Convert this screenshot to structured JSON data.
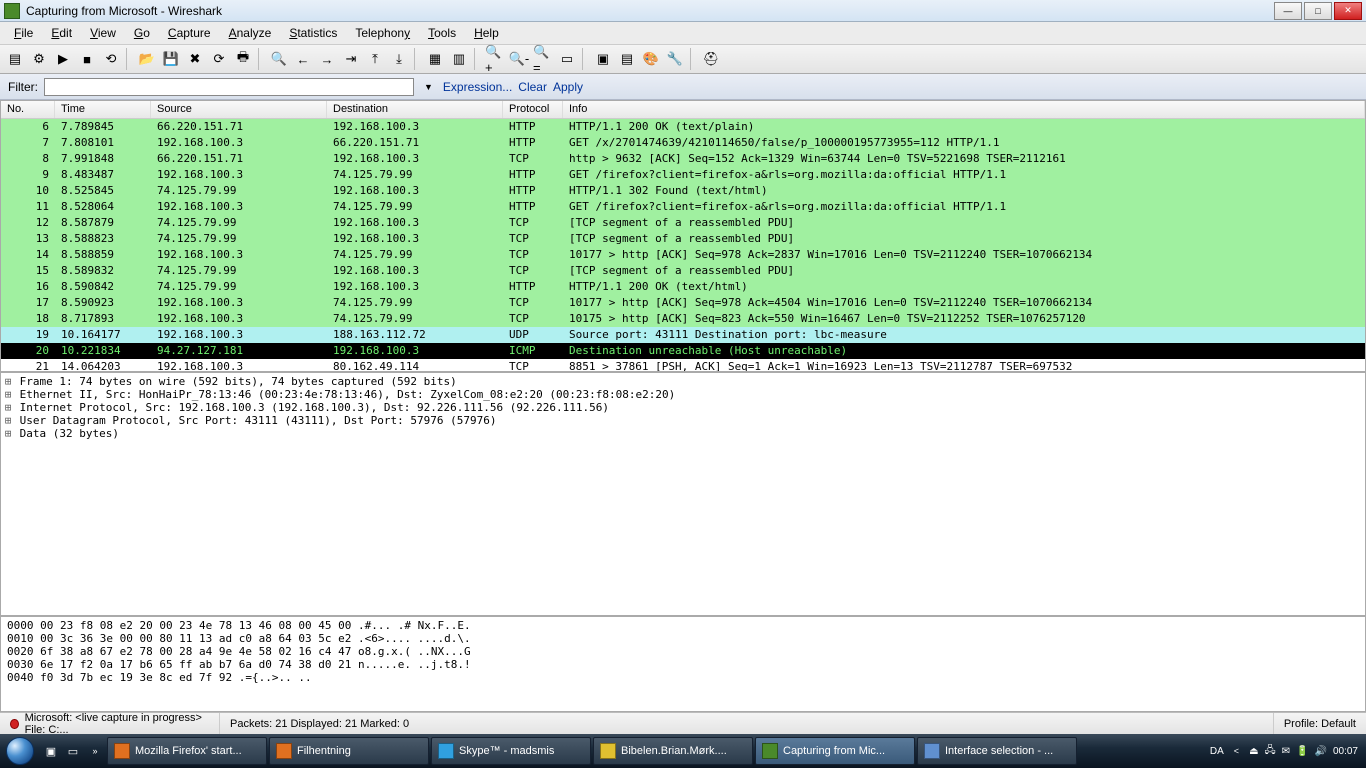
{
  "window": {
    "title": "Capturing from Microsoft - Wireshark"
  },
  "menu": {
    "file": "File",
    "edit": "Edit",
    "view": "View",
    "go": "Go",
    "capture": "Capture",
    "analyze": "Analyze",
    "statistics": "Statistics",
    "telephony": "Telephony",
    "tools": "Tools",
    "help": "Help"
  },
  "filter": {
    "label": "Filter:",
    "value": "",
    "expression": "Expression...",
    "clear": "Clear",
    "apply": "Apply"
  },
  "columns": {
    "no": "No.",
    "time": "Time",
    "source": "Source",
    "destination": "Destination",
    "protocol": "Protocol",
    "info": "Info"
  },
  "packets": [
    {
      "no": "6",
      "time": "7.789845",
      "src": "66.220.151.71",
      "dst": "192.168.100.3",
      "proto": "HTTP",
      "info": "HTTP/1.1 200 OK  (text/plain)",
      "cls": "row-green"
    },
    {
      "no": "7",
      "time": "7.808101",
      "src": "192.168.100.3",
      "dst": "66.220.151.71",
      "proto": "HTTP",
      "info": "GET /x/2701474639/4210114650/false/p_100000195773955=112 HTTP/1.1",
      "cls": "row-green"
    },
    {
      "no": "8",
      "time": "7.991848",
      "src": "66.220.151.71",
      "dst": "192.168.100.3",
      "proto": "TCP",
      "info": "http > 9632 [ACK] Seq=152 Ack=1329 Win=63744 Len=0 TSV=5221698 TSER=2112161",
      "cls": "row-green"
    },
    {
      "no": "9",
      "time": "8.483487",
      "src": "192.168.100.3",
      "dst": "74.125.79.99",
      "proto": "HTTP",
      "info": "GET /firefox?client=firefox-a&rls=org.mozilla:da:official HTTP/1.1",
      "cls": "row-green"
    },
    {
      "no": "10",
      "time": "8.525845",
      "src": "74.125.79.99",
      "dst": "192.168.100.3",
      "proto": "HTTP",
      "info": "HTTP/1.1 302 Found  (text/html)",
      "cls": "row-green"
    },
    {
      "no": "11",
      "time": "8.528064",
      "src": "192.168.100.3",
      "dst": "74.125.79.99",
      "proto": "HTTP",
      "info": "GET /firefox?client=firefox-a&rls=org.mozilla:da:official HTTP/1.1",
      "cls": "row-green"
    },
    {
      "no": "12",
      "time": "8.587879",
      "src": "74.125.79.99",
      "dst": "192.168.100.3",
      "proto": "TCP",
      "info": "[TCP segment of a reassembled PDU]",
      "cls": "row-green"
    },
    {
      "no": "13",
      "time": "8.588823",
      "src": "74.125.79.99",
      "dst": "192.168.100.3",
      "proto": "TCP",
      "info": "[TCP segment of a reassembled PDU]",
      "cls": "row-green"
    },
    {
      "no": "14",
      "time": "8.588859",
      "src": "192.168.100.3",
      "dst": "74.125.79.99",
      "proto": "TCP",
      "info": "10177 > http [ACK] Seq=978 Ack=2837 Win=17016 Len=0 TSV=2112240 TSER=1070662134",
      "cls": "row-green"
    },
    {
      "no": "15",
      "time": "8.589832",
      "src": "74.125.79.99",
      "dst": "192.168.100.3",
      "proto": "TCP",
      "info": "[TCP segment of a reassembled PDU]",
      "cls": "row-green"
    },
    {
      "no": "16",
      "time": "8.590842",
      "src": "74.125.79.99",
      "dst": "192.168.100.3",
      "proto": "HTTP",
      "info": "HTTP/1.1 200 OK  (text/html)",
      "cls": "row-green"
    },
    {
      "no": "17",
      "time": "8.590923",
      "src": "192.168.100.3",
      "dst": "74.125.79.99",
      "proto": "TCP",
      "info": "10177 > http [ACK] Seq=978 Ack=4504 Win=17016 Len=0 TSV=2112240 TSER=1070662134",
      "cls": "row-green"
    },
    {
      "no": "18",
      "time": "8.717893",
      "src": "192.168.100.3",
      "dst": "74.125.79.99",
      "proto": "TCP",
      "info": "10175 > http [ACK] Seq=823 Ack=550 Win=16467 Len=0 TSV=2112252 TSER=1076257120",
      "cls": "row-green"
    },
    {
      "no": "19",
      "time": "10.164177",
      "src": "192.168.100.3",
      "dst": "188.163.112.72",
      "proto": "UDP",
      "info": "Source port: 43111  Destination port: lbc-measure",
      "cls": "row-cyan"
    },
    {
      "no": "20",
      "time": "10.221834",
      "src": "94.27.127.181",
      "dst": "192.168.100.3",
      "proto": "ICMP",
      "info": "Destination unreachable (Host unreachable)",
      "cls": "row-black"
    },
    {
      "no": "21",
      "time": "14.064203",
      "src": "192.168.100.3",
      "dst": "80.162.49.114",
      "proto": "TCP",
      "info": "8851 > 37861 [PSH, ACK] Seq=1 Ack=1 Win=16923 Len=13 TSV=2112787 TSER=697532",
      "cls": "row-white"
    }
  ],
  "details": [
    "Frame 1: 74 bytes on wire (592 bits), 74 bytes captured (592 bits)",
    "Ethernet II, Src: HonHaiPr_78:13:46 (00:23:4e:78:13:46), Dst: ZyxelCom_08:e2:20 (00:23:f8:08:e2:20)",
    "Internet Protocol, Src: 192.168.100.3 (192.168.100.3), Dst: 92.226.111.56 (92.226.111.56)",
    "User Datagram Protocol, Src Port: 43111 (43111), Dst Port: 57976 (57976)",
    "Data (32 bytes)"
  ],
  "hex": [
    "0000  00 23 f8 08 e2 20 00 23  4e 78 13 46 08 00 45 00   .#... .# Nx.F..E.",
    "0010  00 3c 36 3e 00 00 80 11  13 ad c0 a8 64 03 5c e2   .<6>.... ....d.\\.",
    "0020  6f 38 a8 67 e2 78 00 28  a4 9e 4e 58 02 16 c4 47   o8.g.x.( ..NX...G",
    "0030  6e 17 f2 0a 17 b6 65 ff  ab b7 6a d0 74 38 d0 21   n.....e. ..j.t8.!",
    "0040  f0 3d 7b ec 19 3e 8c ed  7f 92                     .={..>.. .."
  ],
  "status": {
    "left": "Microsoft: <live capture in progress> File: C:...",
    "center": "Packets: 21 Displayed: 21 Marked: 0",
    "right": "Profile: Default"
  },
  "taskbar": {
    "items": [
      {
        "label": "Mozilla Firefox' start...",
        "ico": "#e07020"
      },
      {
        "label": "Filhentning",
        "ico": "#e07020"
      },
      {
        "label": "Skype™ - madsmis",
        "ico": "#30a0e0"
      },
      {
        "label": "Bibelen.Brian.Mørk....",
        "ico": "#e0c030"
      },
      {
        "label": "Capturing from Mic...",
        "ico": "#4a8a2a",
        "active": true
      },
      {
        "label": "Interface selection - ...",
        "ico": "#6090d0"
      }
    ],
    "lang": "DA",
    "clock": "00:07"
  }
}
